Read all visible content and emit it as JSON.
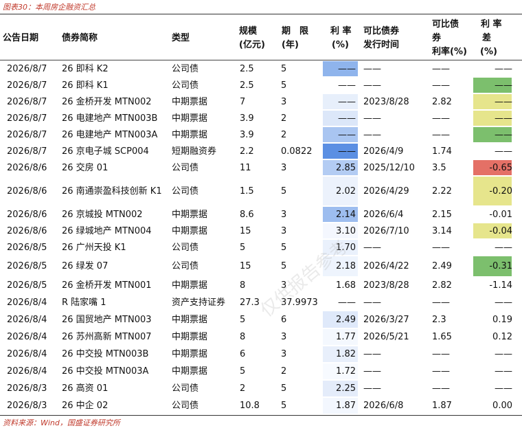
{
  "caption": "图表30：本周房企融资汇总",
  "source": "资料来源：Wind，国盛证券研究所",
  "watermark": "仅供报告参考",
  "headers": {
    "date": "公告日期",
    "name": "债券简称",
    "type": "类型",
    "scale_1": "规模",
    "scale_2": "(亿元)",
    "term_1": "期　限",
    "term_2": "(年)",
    "rate_1": "利 率",
    "rate_2": "(%)",
    "cmp_time_1": "可比债券",
    "cmp_time_2": "发行时间",
    "cmp_rate_1": "可比债",
    "cmp_rate_2": "券",
    "cmp_rate_3": "利率(%)",
    "spread_1": "利 率",
    "spread_2": "差",
    "spread_3": "(%)"
  },
  "rows": [
    {
      "date": "2026/8/7",
      "name": "26 即科 K2",
      "type": "公司债",
      "scale": "2.5",
      "term": "5",
      "rate": "——",
      "cmp_time": "——",
      "cmp_rate": "——",
      "spread": "——"
    },
    {
      "date": "2026/8/7",
      "name": "26 即科 K1",
      "type": "公司债",
      "scale": "2.5",
      "term": "5",
      "rate": "——",
      "cmp_time": "——",
      "cmp_rate": "——",
      "spread": "——"
    },
    {
      "date": "2026/8/7",
      "name": "26 金桥开发 MTN002",
      "type": "中期票据",
      "scale": "7",
      "term": "3",
      "rate": "——",
      "cmp_time": "2023/8/28",
      "cmp_rate": "2.82",
      "spread": "——"
    },
    {
      "date": "2026/8/7",
      "name": "26 电建地产 MTN003B",
      "type": "中期票据",
      "scale": "3.9",
      "term": "2",
      "rate": "——",
      "cmp_time": "——",
      "cmp_rate": "——",
      "spread": "——"
    },
    {
      "date": "2026/8/7",
      "name": "26 电建地产 MTN003A",
      "type": "中期票据",
      "scale": "3.9",
      "term": "2",
      "rate": "——",
      "cmp_time": "——",
      "cmp_rate": "——",
      "spread": "——"
    },
    {
      "date": "2026/8/7",
      "name": "26 京电子城 SCP004",
      "type": "短期融资券",
      "scale": "2.2",
      "term": "0.0822",
      "rate": "——",
      "cmp_time": "2026/4/9",
      "cmp_rate": "1.74",
      "spread": "——"
    },
    {
      "date": "2026/8/6",
      "name": "26 交房 01",
      "type": "公司债",
      "scale": "11",
      "term": "3",
      "rate": "2.85",
      "cmp_time": "2025/12/10",
      "cmp_rate": "3.5",
      "spread": "-0.65"
    },
    {
      "date": "2026/8/6",
      "name": "26 南通崇盈科技创新 K1",
      "type": "公司债",
      "scale": "1.5",
      "term": "5",
      "rate": "2.02",
      "cmp_time": "2026/4/29",
      "cmp_rate": "2.22",
      "spread": "-0.20"
    },
    {
      "date": "2026/8/6",
      "name": "26 京城投 MTN002",
      "type": "中期票据",
      "scale": "8.6",
      "term": "3",
      "rate": "2.14",
      "cmp_time": "2026/6/4",
      "cmp_rate": "2.15",
      "spread": "-0.01"
    },
    {
      "date": "2026/8/6",
      "name": "26 绿城地产 MTN004",
      "type": "中期票据",
      "scale": "15",
      "term": "3",
      "rate": "3.10",
      "cmp_time": "2026/7/10",
      "cmp_rate": "3.14",
      "spread": "-0.04"
    },
    {
      "date": "2026/8/5",
      "name": "26 广州天投 K1",
      "type": "公司债",
      "scale": "5",
      "term": "5",
      "rate": "1.70",
      "cmp_time": "——",
      "cmp_rate": "——",
      "spread": "——"
    },
    {
      "date": "2026/8/5",
      "name": "26 绿发 07",
      "type": "公司债",
      "scale": "15",
      "term": "5",
      "rate": "2.18",
      "cmp_time": "2026/4/22",
      "cmp_rate": "2.49",
      "spread": "-0.31"
    },
    {
      "date": "2026/8/5",
      "name": "26 金桥开发 MTN001",
      "type": "中期票据",
      "scale": "8",
      "term": "3",
      "rate": "1.68",
      "cmp_time": "2023/8/28",
      "cmp_rate": "2.82",
      "spread": "-1.14"
    },
    {
      "date": "2026/8/4",
      "name": "R 陆家嘴 1",
      "type": "资产支持证券",
      "scale": "27.3",
      "term": "37.9973",
      "rate": "——",
      "cmp_time": "——",
      "cmp_rate": "——",
      "spread": "——"
    },
    {
      "date": "2026/8/4",
      "name": "26 国贸地产 MTN003",
      "type": "中期票据",
      "scale": "5",
      "term": "6",
      "rate": "2.49",
      "cmp_time": "2026/3/27",
      "cmp_rate": "2.3",
      "spread": "0.19"
    },
    {
      "date": "2026/8/4",
      "name": "26 苏州高新 MTN007",
      "type": "中期票据",
      "scale": "8",
      "term": "3",
      "rate": "1.77",
      "cmp_time": "2026/5/21",
      "cmp_rate": "1.65",
      "spread": "0.12"
    },
    {
      "date": "2026/8/4",
      "name": "26 中交投 MTN003B",
      "type": "中期票据",
      "scale": "6",
      "term": "3",
      "rate": "1.82",
      "cmp_time": "——",
      "cmp_rate": "——",
      "spread": "——"
    },
    {
      "date": "2026/8/4",
      "name": "26 中交投 MTN003A",
      "type": "中期票据",
      "scale": "5",
      "term": "2",
      "rate": "1.72",
      "cmp_time": "——",
      "cmp_rate": "——",
      "spread": "——"
    },
    {
      "date": "2026/8/3",
      "name": "26 高资 01",
      "type": "公司债",
      "scale": "2",
      "term": "5",
      "rate": "2.25",
      "cmp_time": "——",
      "cmp_rate": "——",
      "spread": "——"
    },
    {
      "date": "2026/8/3",
      "name": "26 中企 02",
      "type": "公司债",
      "scale": "10.8",
      "term": "5",
      "rate": "1.87",
      "cmp_time": "2026/6/8",
      "cmp_rate": "1.87",
      "spread": "0.00"
    }
  ],
  "rate_fill_colors": [
    "#8fb4ec",
    "#ffffff",
    "#e7effb",
    "#dce7f9",
    "#a9c5f1",
    "#5b8fe3",
    "#b3ccf3",
    "#ecf2fc",
    "#9dbdef",
    "#f4f7fe",
    "#eaf1fc",
    "#eef4fd",
    "#ffffff",
    "#ffffff",
    "#dfe9fa",
    "#f4f8fe",
    "#e8effb",
    "#f7faff",
    "#e4ecfa",
    "#f3f7fe"
  ],
  "spread_fill_colors": [
    "#ffffff",
    "#7cbf6d",
    "#e6e58c",
    "#e6e58c",
    "#7cbf6d",
    "#ffffff",
    "#e47066",
    "#e6e58c",
    "#ffffff",
    "#e6e58c",
    "#ffffff",
    "#7cbf6d",
    "#ffffff",
    "#ffffff",
    "#ffffff",
    "#ffffff",
    "#ffffff",
    "#ffffff",
    "#ffffff",
    "#ffffff"
  ]
}
